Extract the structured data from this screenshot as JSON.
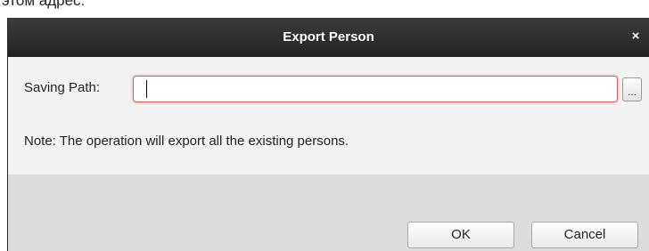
{
  "top_caption": "этом адрес:",
  "dialog": {
    "title": "Export Person",
    "close_glyph": "×"
  },
  "form": {
    "saving_path_label": "Saving Path:",
    "saving_path_value": "",
    "browse_label": "...",
    "note": "Note: The operation will export all the existing persons."
  },
  "buttons": {
    "ok": "OK",
    "cancel": "Cancel"
  },
  "colors": {
    "titlebar": "#2a2a2a",
    "input_error_border": "#d36060",
    "footer": "#dcdcdc"
  }
}
